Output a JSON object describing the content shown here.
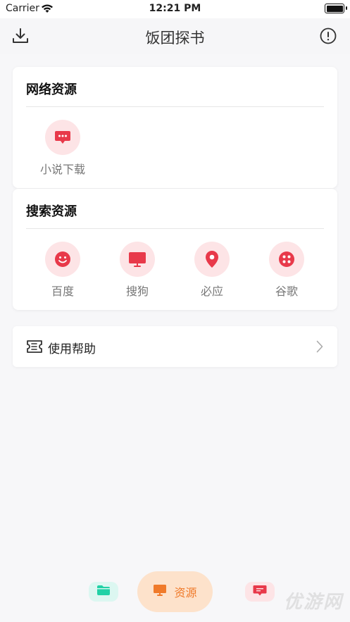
{
  "status_bar": {
    "carrier": "Carrier",
    "time": "12:21 PM"
  },
  "nav": {
    "title": "饭团探书",
    "left_icon": "download-icon",
    "right_icon": "info-icon"
  },
  "sections": {
    "network": {
      "title": "网络资源",
      "items": [
        {
          "label": "小说下载",
          "icon": "message-dots-icon"
        }
      ]
    },
    "search": {
      "title": "搜索资源",
      "items": [
        {
          "label": "百度",
          "icon": "smile-icon"
        },
        {
          "label": "搜狗",
          "icon": "monitor-icon"
        },
        {
          "label": "必应",
          "icon": "location-pin-icon"
        },
        {
          "label": "谷歌",
          "icon": "dots-grid-icon"
        }
      ]
    }
  },
  "help": {
    "label": "使用帮助"
  },
  "tabbar": {
    "files_icon": "folder-icon",
    "resources_label": "资源",
    "messages_icon": "message-icon"
  },
  "watermark": "优游网",
  "colors": {
    "accent_red": "#e8394a",
    "icon_bg": "#fde4e6",
    "tab_teal": "#21d1a6",
    "tab_orange": "#f07a2a"
  }
}
